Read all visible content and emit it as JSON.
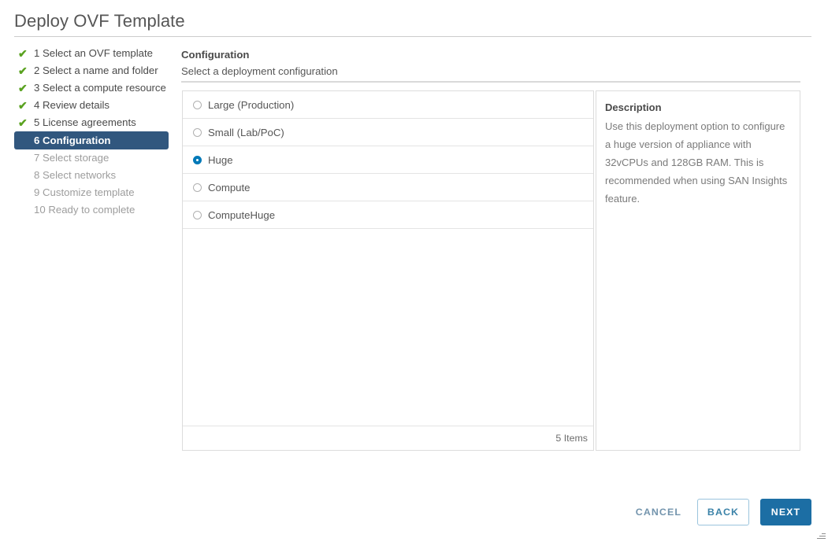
{
  "wizard": {
    "title": "Deploy OVF Template",
    "steps": [
      {
        "label": "1 Select an OVF template",
        "state": "done",
        "icon": "check-icon"
      },
      {
        "label": "2 Select a name and folder",
        "state": "done",
        "icon": "check-icon"
      },
      {
        "label": "3 Select a compute resource",
        "state": "done",
        "icon": "check-icon"
      },
      {
        "label": "4 Review details",
        "state": "done",
        "icon": "check-icon"
      },
      {
        "label": "5 License agreements",
        "state": "done",
        "icon": "check-icon"
      },
      {
        "label": "6 Configuration",
        "state": "active",
        "icon": ""
      },
      {
        "label": "7 Select storage",
        "state": "todo",
        "icon": ""
      },
      {
        "label": "8 Select networks",
        "state": "todo",
        "icon": ""
      },
      {
        "label": "9 Customize template",
        "state": "todo",
        "icon": ""
      },
      {
        "label": "10 Ready to complete",
        "state": "todo",
        "icon": ""
      }
    ]
  },
  "content": {
    "title": "Configuration",
    "subtitle": "Select a deployment configuration"
  },
  "configuration_list": {
    "options": [
      {
        "label": "Large (Production)",
        "selected": false
      },
      {
        "label": "Small (Lab/PoC)",
        "selected": false
      },
      {
        "label": "Huge",
        "selected": true
      },
      {
        "label": "Compute",
        "selected": false
      },
      {
        "label": "ComputeHuge",
        "selected": false
      }
    ],
    "item_count_label": "5 Items"
  },
  "description": {
    "title": "Description",
    "text": "Use this deployment option to configure a huge version of appliance with 32vCPUs and 128GB RAM. This is recommended when using SAN Insights feature."
  },
  "footer": {
    "cancel_label": "CANCEL",
    "back_label": "BACK",
    "next_label": "NEXT"
  },
  "colors": {
    "active_step_bg": "#31577e",
    "check_green": "#5aa220",
    "radio_blue": "#0079b8",
    "next_button_bg": "#1c6ea4",
    "back_button_border": "#9bc4dd",
    "cancel_text": "#7394ad"
  }
}
